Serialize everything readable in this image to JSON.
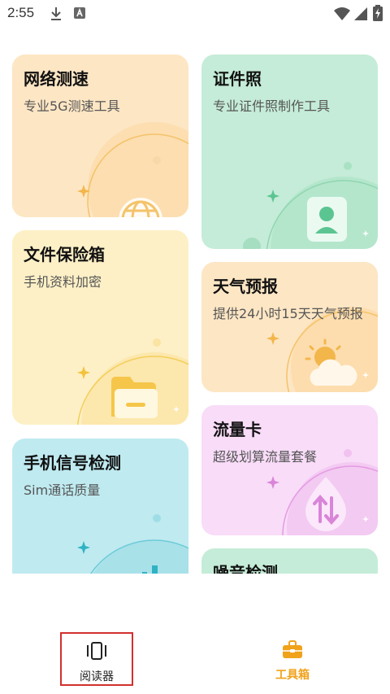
{
  "status_bar": {
    "time": "2:55",
    "icons": [
      "download-icon",
      "app-a-icon",
      "wifi-icon",
      "signal-icon",
      "battery-charging-icon"
    ]
  },
  "cards": {
    "speed_test": {
      "title": "网络测速",
      "subtitle": "专业5G测速工具",
      "icon": "globe-icon",
      "color": "#fde6c4"
    },
    "id_photo": {
      "title": "证件照",
      "subtitle": "专业证件照制作工具",
      "icon": "id-person-icon",
      "color": "#c5ecd8"
    },
    "file_safe": {
      "title": "文件保险箱",
      "subtitle": "手机资料加密",
      "icon": "folder-icon",
      "color": "#fdf0c6"
    },
    "weather": {
      "title": "天气预报",
      "subtitle": "提供24小时15天天气预报",
      "icon": "sun-cloud-icon",
      "color": "#fde6c4"
    },
    "signal": {
      "title": "手机信号检测",
      "subtitle": "Sim通话质量",
      "icon": "signal-bars-icon",
      "color": "#bfeaf0"
    },
    "data_card": {
      "title": "流量卡",
      "subtitle": "超级划算流量套餐",
      "icon": "data-arrows-icon",
      "color": "#f8dcf8"
    },
    "noise": {
      "title": "噪音检测",
      "color": "#c5ecd8"
    }
  },
  "bottom_nav": {
    "reader_label": "阅读器",
    "tools_label": "工具箱",
    "active_color": "#f0a21b"
  }
}
